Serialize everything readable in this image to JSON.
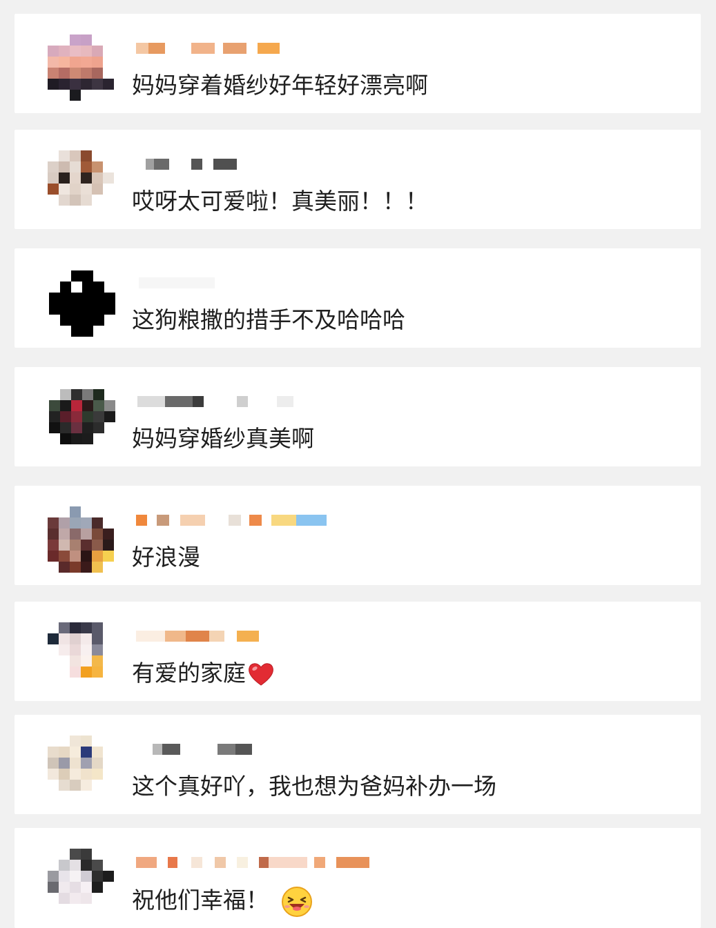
{
  "comments": [
    {
      "text": "妈妈穿着婚纱好年轻好漂亮啊"
    },
    {
      "text": "哎呀太可爱啦！真美丽！！！"
    },
    {
      "text": "这狗粮撒的措手不及哈哈哈"
    },
    {
      "text": "妈妈穿婚纱真美啊"
    },
    {
      "text": "好浪漫"
    },
    {
      "text": "有爱的家庭",
      "icon": "red-heart-emoji"
    },
    {
      "text": "这个真好吖，我也想为爸妈补办一场"
    },
    {
      "text": "祝他们幸福！",
      "icon": "laughing-face-emoji"
    }
  ],
  "colors": {
    "background": "#f1f1f1",
    "card": "#ffffff",
    "text": "#1f1f1f"
  }
}
